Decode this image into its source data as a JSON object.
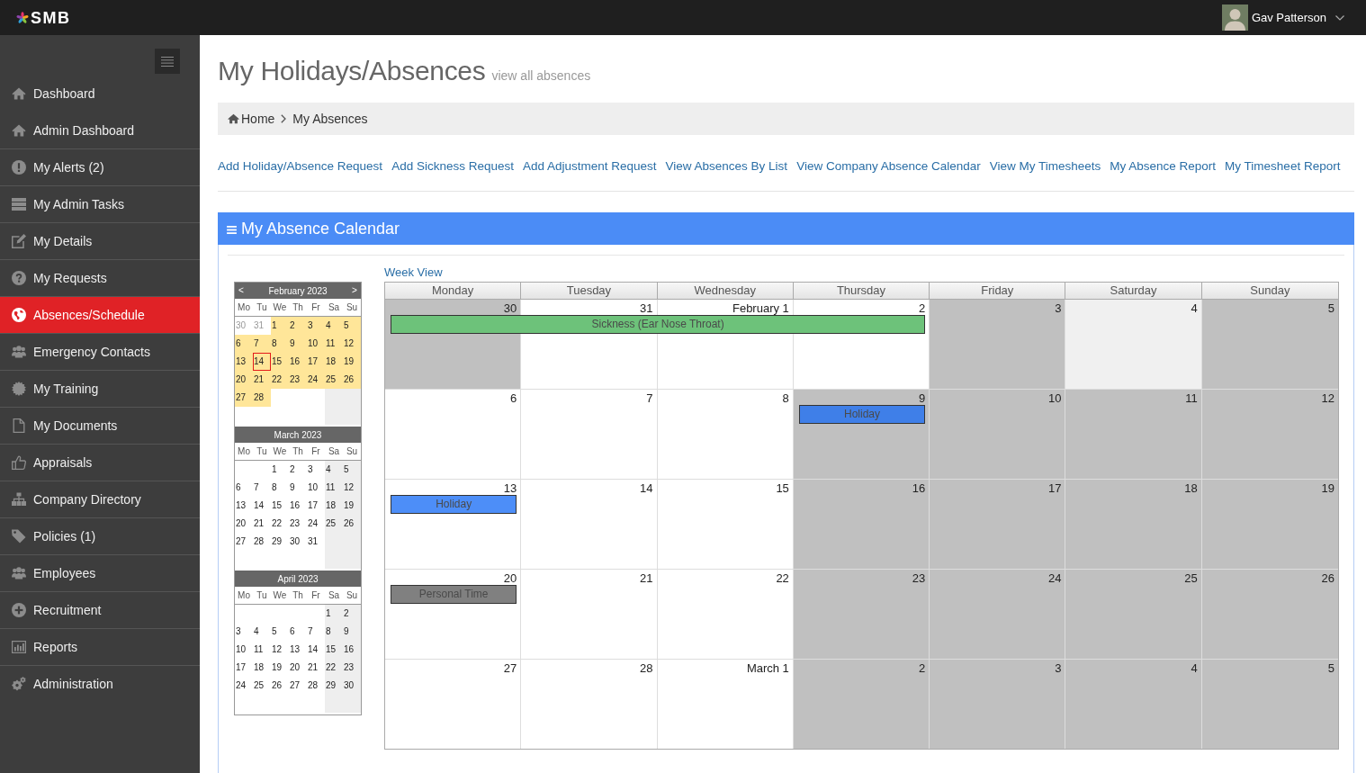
{
  "topbar": {
    "logo": "SMB",
    "user": {
      "name": "Gav Patterson"
    }
  },
  "sidebar": {
    "items": [
      {
        "label": "Dashboard",
        "selected": false
      },
      {
        "label": "Admin Dashboard",
        "selected": false
      },
      {
        "label": "My Alerts (2)",
        "selected": false
      },
      {
        "label": "My Admin Tasks",
        "selected": false
      },
      {
        "label": "My Details",
        "selected": false
      },
      {
        "label": "My Requests",
        "selected": false
      },
      {
        "label": "Absences/Schedule",
        "selected": true
      },
      {
        "label": "Emergency Contacts",
        "selected": false
      },
      {
        "label": "My Training",
        "selected": false
      },
      {
        "label": "My Documents",
        "selected": false
      },
      {
        "label": "Appraisals",
        "selected": false
      },
      {
        "label": "Company Directory",
        "selected": false
      },
      {
        "label": "Policies (1)",
        "selected": false
      },
      {
        "label": "Employees",
        "selected": false
      },
      {
        "label": "Recruitment",
        "selected": false
      },
      {
        "label": "Reports",
        "selected": false
      },
      {
        "label": "Administration",
        "selected": false
      }
    ]
  },
  "page": {
    "title": "My Holidays/Absences",
    "subtitle": "view all absences"
  },
  "breadcrumb": [
    {
      "label": "Home"
    },
    {
      "label": "My Absences"
    }
  ],
  "actions": [
    "Add Holiday/Absence Request",
    "Add Sickness Request",
    "Add Adjustment Request",
    "View Absences By List",
    "View Company Absence Calendar",
    "View My Timesheets",
    "My Absence Report",
    "My Timesheet Report"
  ],
  "panel": {
    "title": "My Absence Calendar",
    "mini_calendars": [
      {
        "title": "February 2023",
        "prev": "<",
        "next": ">",
        "weekdays": [
          "Mo",
          "Tu",
          "We",
          "Th",
          "Fr",
          "Sa",
          "Su"
        ],
        "weeks": [
          [
            {
              "day": "30",
              "kind": "outside",
              "today": false
            },
            {
              "day": "31",
              "kind": "outside",
              "today": false
            },
            {
              "day": "1",
              "kind": "range",
              "today": false
            },
            {
              "day": "2",
              "kind": "range",
              "today": false
            },
            {
              "day": "3",
              "kind": "range",
              "today": false
            },
            {
              "day": "4",
              "kind": "range",
              "today": false
            },
            {
              "day": "5",
              "kind": "range",
              "today": false
            }
          ],
          [
            {
              "day": "6",
              "kind": "range",
              "today": false
            },
            {
              "day": "7",
              "kind": "range",
              "today": false
            },
            {
              "day": "8",
              "kind": "range",
              "today": false
            },
            {
              "day": "9",
              "kind": "range",
              "today": false
            },
            {
              "day": "10",
              "kind": "range",
              "today": false
            },
            {
              "day": "11",
              "kind": "range",
              "today": false
            },
            {
              "day": "12",
              "kind": "range",
              "today": false
            }
          ],
          [
            {
              "day": "13",
              "kind": "range",
              "today": false
            },
            {
              "day": "14",
              "kind": "range",
              "today": true
            },
            {
              "day": "15",
              "kind": "range",
              "today": false
            },
            {
              "day": "16",
              "kind": "range",
              "today": false
            },
            {
              "day": "17",
              "kind": "range",
              "today": false
            },
            {
              "day": "18",
              "kind": "range",
              "today": false
            },
            {
              "day": "19",
              "kind": "range",
              "today": false
            }
          ],
          [
            {
              "day": "20",
              "kind": "range",
              "today": false
            },
            {
              "day": "21",
              "kind": "range",
              "today": false
            },
            {
              "day": "22",
              "kind": "range",
              "today": false
            },
            {
              "day": "23",
              "kind": "range",
              "today": false
            },
            {
              "day": "24",
              "kind": "range",
              "today": false
            },
            {
              "day": "25",
              "kind": "range",
              "today": false
            },
            {
              "day": "26",
              "kind": "range",
              "today": false
            }
          ],
          [
            {
              "day": "27",
              "kind": "range",
              "today": false
            },
            {
              "day": "28",
              "kind": "range",
              "today": false
            }
          ]
        ]
      },
      {
        "title": "March 2023",
        "weekdays": [
          "Mo",
          "Tu",
          "We",
          "Th",
          "Fr",
          "Sa",
          "Su"
        ],
        "weeks": [
          [
            {
              "day": "1",
              "kind": "plain",
              "today": false
            },
            {
              "day": "2",
              "kind": "plain",
              "today": false
            },
            {
              "day": "3",
              "kind": "plain",
              "today": false
            },
            {
              "day": "4",
              "kind": "plain",
              "today": false
            },
            {
              "day": "5",
              "kind": "plain",
              "today": false
            }
          ],
          [
            {
              "day": "6",
              "kind": "plain",
              "today": false
            },
            {
              "day": "7",
              "kind": "plain",
              "today": false
            },
            {
              "day": "8",
              "kind": "plain",
              "today": false
            },
            {
              "day": "9",
              "kind": "plain",
              "today": false
            },
            {
              "day": "10",
              "kind": "plain",
              "today": false
            },
            {
              "day": "11",
              "kind": "plain",
              "today": false
            },
            {
              "day": "12",
              "kind": "plain",
              "today": false
            }
          ],
          [
            {
              "day": "13",
              "kind": "plain",
              "today": false
            },
            {
              "day": "14",
              "kind": "plain",
              "today": false
            },
            {
              "day": "15",
              "kind": "plain",
              "today": false
            },
            {
              "day": "16",
              "kind": "plain",
              "today": false
            },
            {
              "day": "17",
              "kind": "plain",
              "today": false
            },
            {
              "day": "18",
              "kind": "plain",
              "today": false
            },
            {
              "day": "19",
              "kind": "plain",
              "today": false
            }
          ],
          [
            {
              "day": "20",
              "kind": "plain",
              "today": false
            },
            {
              "day": "21",
              "kind": "plain",
              "today": false
            },
            {
              "day": "22",
              "kind": "plain",
              "today": false
            },
            {
              "day": "23",
              "kind": "plain",
              "today": false
            },
            {
              "day": "24",
              "kind": "plain",
              "today": false
            },
            {
              "day": "25",
              "kind": "plain",
              "today": false
            },
            {
              "day": "26",
              "kind": "plain",
              "today": false
            }
          ],
          [
            {
              "day": "27",
              "kind": "plain",
              "today": false
            },
            {
              "day": "28",
              "kind": "plain",
              "today": false
            },
            {
              "day": "29",
              "kind": "plain",
              "today": false
            },
            {
              "day": "30",
              "kind": "plain",
              "today": false
            },
            {
              "day": "31",
              "kind": "plain",
              "today": false
            }
          ]
        ]
      },
      {
        "title": "April 2023",
        "weekdays": [
          "Mo",
          "Tu",
          "We",
          "Th",
          "Fr",
          "Sa",
          "Su"
        ],
        "weeks": [
          [
            {
              "day": "1",
              "kind": "plain",
              "today": false
            },
            {
              "day": "2",
              "kind": "plain",
              "today": false
            }
          ],
          [
            {
              "day": "3",
              "kind": "plain",
              "today": false
            },
            {
              "day": "4",
              "kind": "plain",
              "today": false
            },
            {
              "day": "5",
              "kind": "plain",
              "today": false
            },
            {
              "day": "6",
              "kind": "plain",
              "today": false
            },
            {
              "day": "7",
              "kind": "plain",
              "today": false
            },
            {
              "day": "8",
              "kind": "plain",
              "today": false
            },
            {
              "day": "9",
              "kind": "plain",
              "today": false
            }
          ],
          [
            {
              "day": "10",
              "kind": "plain",
              "today": false
            },
            {
              "day": "11",
              "kind": "plain",
              "today": false
            },
            {
              "day": "12",
              "kind": "plain",
              "today": false
            },
            {
              "day": "13",
              "kind": "plain",
              "today": false
            },
            {
              "day": "14",
              "kind": "plain",
              "today": false
            },
            {
              "day": "15",
              "kind": "plain",
              "today": false
            },
            {
              "day": "16",
              "kind": "plain",
              "today": false
            }
          ],
          [
            {
              "day": "17",
              "kind": "plain",
              "today": false
            },
            {
              "day": "18",
              "kind": "plain",
              "today": false
            },
            {
              "day": "19",
              "kind": "plain",
              "today": false
            },
            {
              "day": "20",
              "kind": "plain",
              "today": false
            },
            {
              "day": "21",
              "kind": "plain",
              "today": false
            },
            {
              "day": "22",
              "kind": "plain",
              "today": false
            },
            {
              "day": "23",
              "kind": "plain",
              "today": false
            }
          ],
          [
            {
              "day": "24",
              "kind": "plain",
              "today": false
            },
            {
              "day": "25",
              "kind": "plain",
              "today": false
            },
            {
              "day": "26",
              "kind": "plain",
              "today": false
            },
            {
              "day": "27",
              "kind": "plain",
              "today": false
            },
            {
              "day": "28",
              "kind": "plain",
              "today": false
            },
            {
              "day": "29",
              "kind": "plain",
              "today": false
            },
            {
              "day": "30",
              "kind": "plain",
              "today": false
            }
          ]
        ]
      }
    ],
    "calendar": {
      "view_link": "Week View",
      "weekdays": [
        "Monday",
        "Tuesday",
        "Wednesday",
        "Thursday",
        "Friday",
        "Saturday",
        "Sunday"
      ],
      "weeks": [
        {
          "days": [
            {
              "date": "30",
              "kind": "nonworking"
            },
            {
              "date": "31",
              "kind": "working"
            },
            {
              "date": "February 1",
              "kind": "working"
            },
            {
              "date": "2",
              "kind": "working"
            },
            {
              "date": "3",
              "kind": "nonworking"
            },
            {
              "date": "4",
              "kind": "muted"
            },
            {
              "date": "5",
              "kind": "nonworking"
            }
          ],
          "events": [
            {
              "label": "Sickness (Ear Nose Throat)",
              "color": "#6dc27a",
              "covers": [
                true,
                true,
                true,
                true,
                false,
                false,
                false
              ]
            }
          ]
        },
        {
          "days": [
            {
              "date": "6",
              "kind": "working"
            },
            {
              "date": "7",
              "kind": "working"
            },
            {
              "date": "8",
              "kind": "working"
            },
            {
              "date": "9",
              "kind": "nonworking"
            },
            {
              "date": "10",
              "kind": "nonworking"
            },
            {
              "date": "11",
              "kind": "nonworking"
            },
            {
              "date": "12",
              "kind": "nonworking"
            }
          ],
          "events": [
            {
              "label": "Holiday",
              "color": "#3f7fe8",
              "covers": [
                false,
                false,
                false,
                true,
                false,
                false,
                false
              ]
            }
          ]
        },
        {
          "days": [
            {
              "date": "13",
              "kind": "working"
            },
            {
              "date": "14",
              "kind": "working"
            },
            {
              "date": "15",
              "kind": "working"
            },
            {
              "date": "16",
              "kind": "nonworking"
            },
            {
              "date": "17",
              "kind": "nonworking"
            },
            {
              "date": "18",
              "kind": "nonworking"
            },
            {
              "date": "19",
              "kind": "nonworking"
            }
          ],
          "events": [
            {
              "label": "Holiday",
              "color": "#4d8ef8",
              "covers": [
                true,
                false,
                false,
                false,
                false,
                false,
                false
              ]
            }
          ]
        },
        {
          "days": [
            {
              "date": "20",
              "kind": "working"
            },
            {
              "date": "21",
              "kind": "working"
            },
            {
              "date": "22",
              "kind": "working"
            },
            {
              "date": "23",
              "kind": "nonworking"
            },
            {
              "date": "24",
              "kind": "nonworking"
            },
            {
              "date": "25",
              "kind": "nonworking"
            },
            {
              "date": "26",
              "kind": "nonworking"
            }
          ],
          "events": [
            {
              "label": "Personal Time",
              "color": "#808080",
              "covers": [
                true,
                false,
                false,
                false,
                false,
                false,
                false
              ]
            }
          ]
        },
        {
          "days": [
            {
              "date": "27",
              "kind": "working"
            },
            {
              "date": "28",
              "kind": "working"
            },
            {
              "date": "March 1",
              "kind": "working"
            },
            {
              "date": "2",
              "kind": "nonworking"
            },
            {
              "date": "3",
              "kind": "nonworking"
            },
            {
              "date": "4",
              "kind": "nonworking"
            },
            {
              "date": "5",
              "kind": "nonworking"
            }
          ]
        }
      ]
    }
  }
}
